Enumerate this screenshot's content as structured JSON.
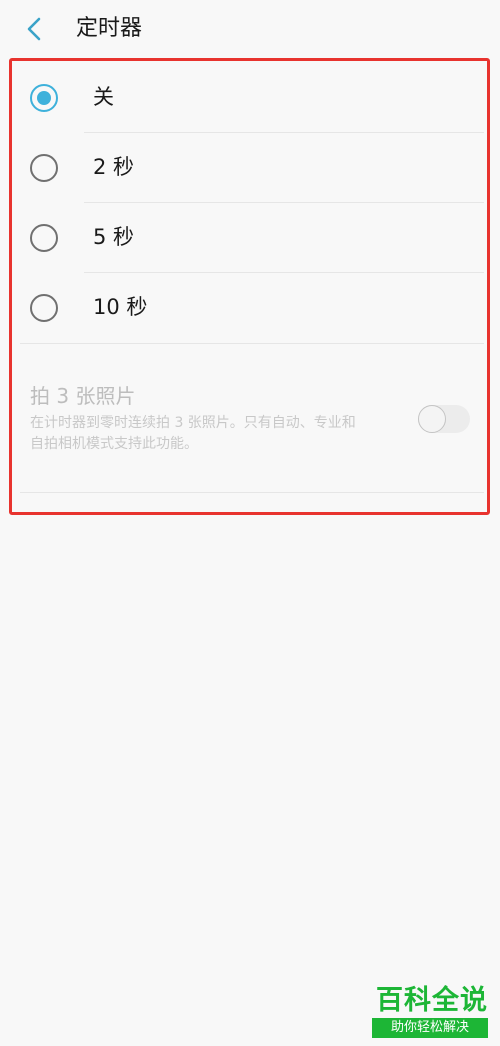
{
  "header": {
    "back_icon": "chevron-left-icon",
    "title": "定时器"
  },
  "options": [
    {
      "label": "关",
      "selected": true
    },
    {
      "label": "2 秒",
      "selected": false
    },
    {
      "label": "5 秒",
      "selected": false
    },
    {
      "label": "10 秒",
      "selected": false
    }
  ],
  "burst": {
    "title": "拍 3 张照片",
    "description": "在计时器到零时连续拍 3 张照片。只有自动、专业和自拍相机模式支持此功能。",
    "toggle_on": false,
    "enabled": false
  },
  "watermark": {
    "main": "百科全说",
    "sub": "助你轻松解决"
  },
  "colors": {
    "accent": "#3eb1db",
    "highlight_border": "#e8332e",
    "watermark_green": "#1db636"
  }
}
